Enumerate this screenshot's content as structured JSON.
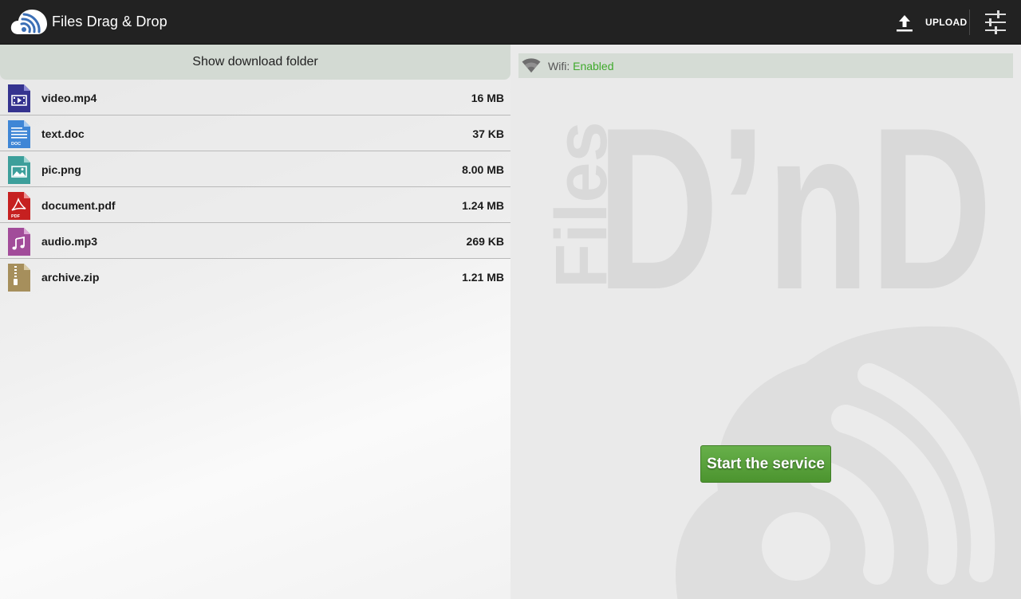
{
  "app": {
    "title": "Files Drag & Drop",
    "logo_icon": "cloud-wifi-icon"
  },
  "toolbar": {
    "upload_label": "UPLOAD",
    "upload_icon": "upload-icon",
    "settings_icon": "sliders-icon"
  },
  "left": {
    "show_folder_label": "Show download folder",
    "files": [
      {
        "name": "video.mp4",
        "size": "16 MB",
        "icon": "video-file-icon",
        "color": "#3a3a9e"
      },
      {
        "name": "text.doc",
        "size": "37 KB",
        "icon": "doc-file-icon",
        "color": "#3f86d6"
      },
      {
        "name": "pic.png",
        "size": "8.00 MB",
        "icon": "image-file-icon",
        "color": "#3d9f9b"
      },
      {
        "name": "document.pdf",
        "size": "1.24 MB",
        "icon": "pdf-file-icon",
        "color": "#c62020"
      },
      {
        "name": "audio.mp3",
        "size": "269 KB",
        "icon": "audio-file-icon",
        "color": "#a24c9a"
      },
      {
        "name": "archive.zip",
        "size": "1.21 MB",
        "icon": "zip-file-icon",
        "color": "#a68f5c"
      }
    ]
  },
  "right": {
    "wifi_label": "Wifi:",
    "wifi_status": "Enabled",
    "wifi_status_color": "#3faa2c",
    "watermark_small": "Files",
    "watermark_large": "D’nD",
    "start_button_label": "Start the service",
    "start_button_color": "#5aa33d"
  }
}
